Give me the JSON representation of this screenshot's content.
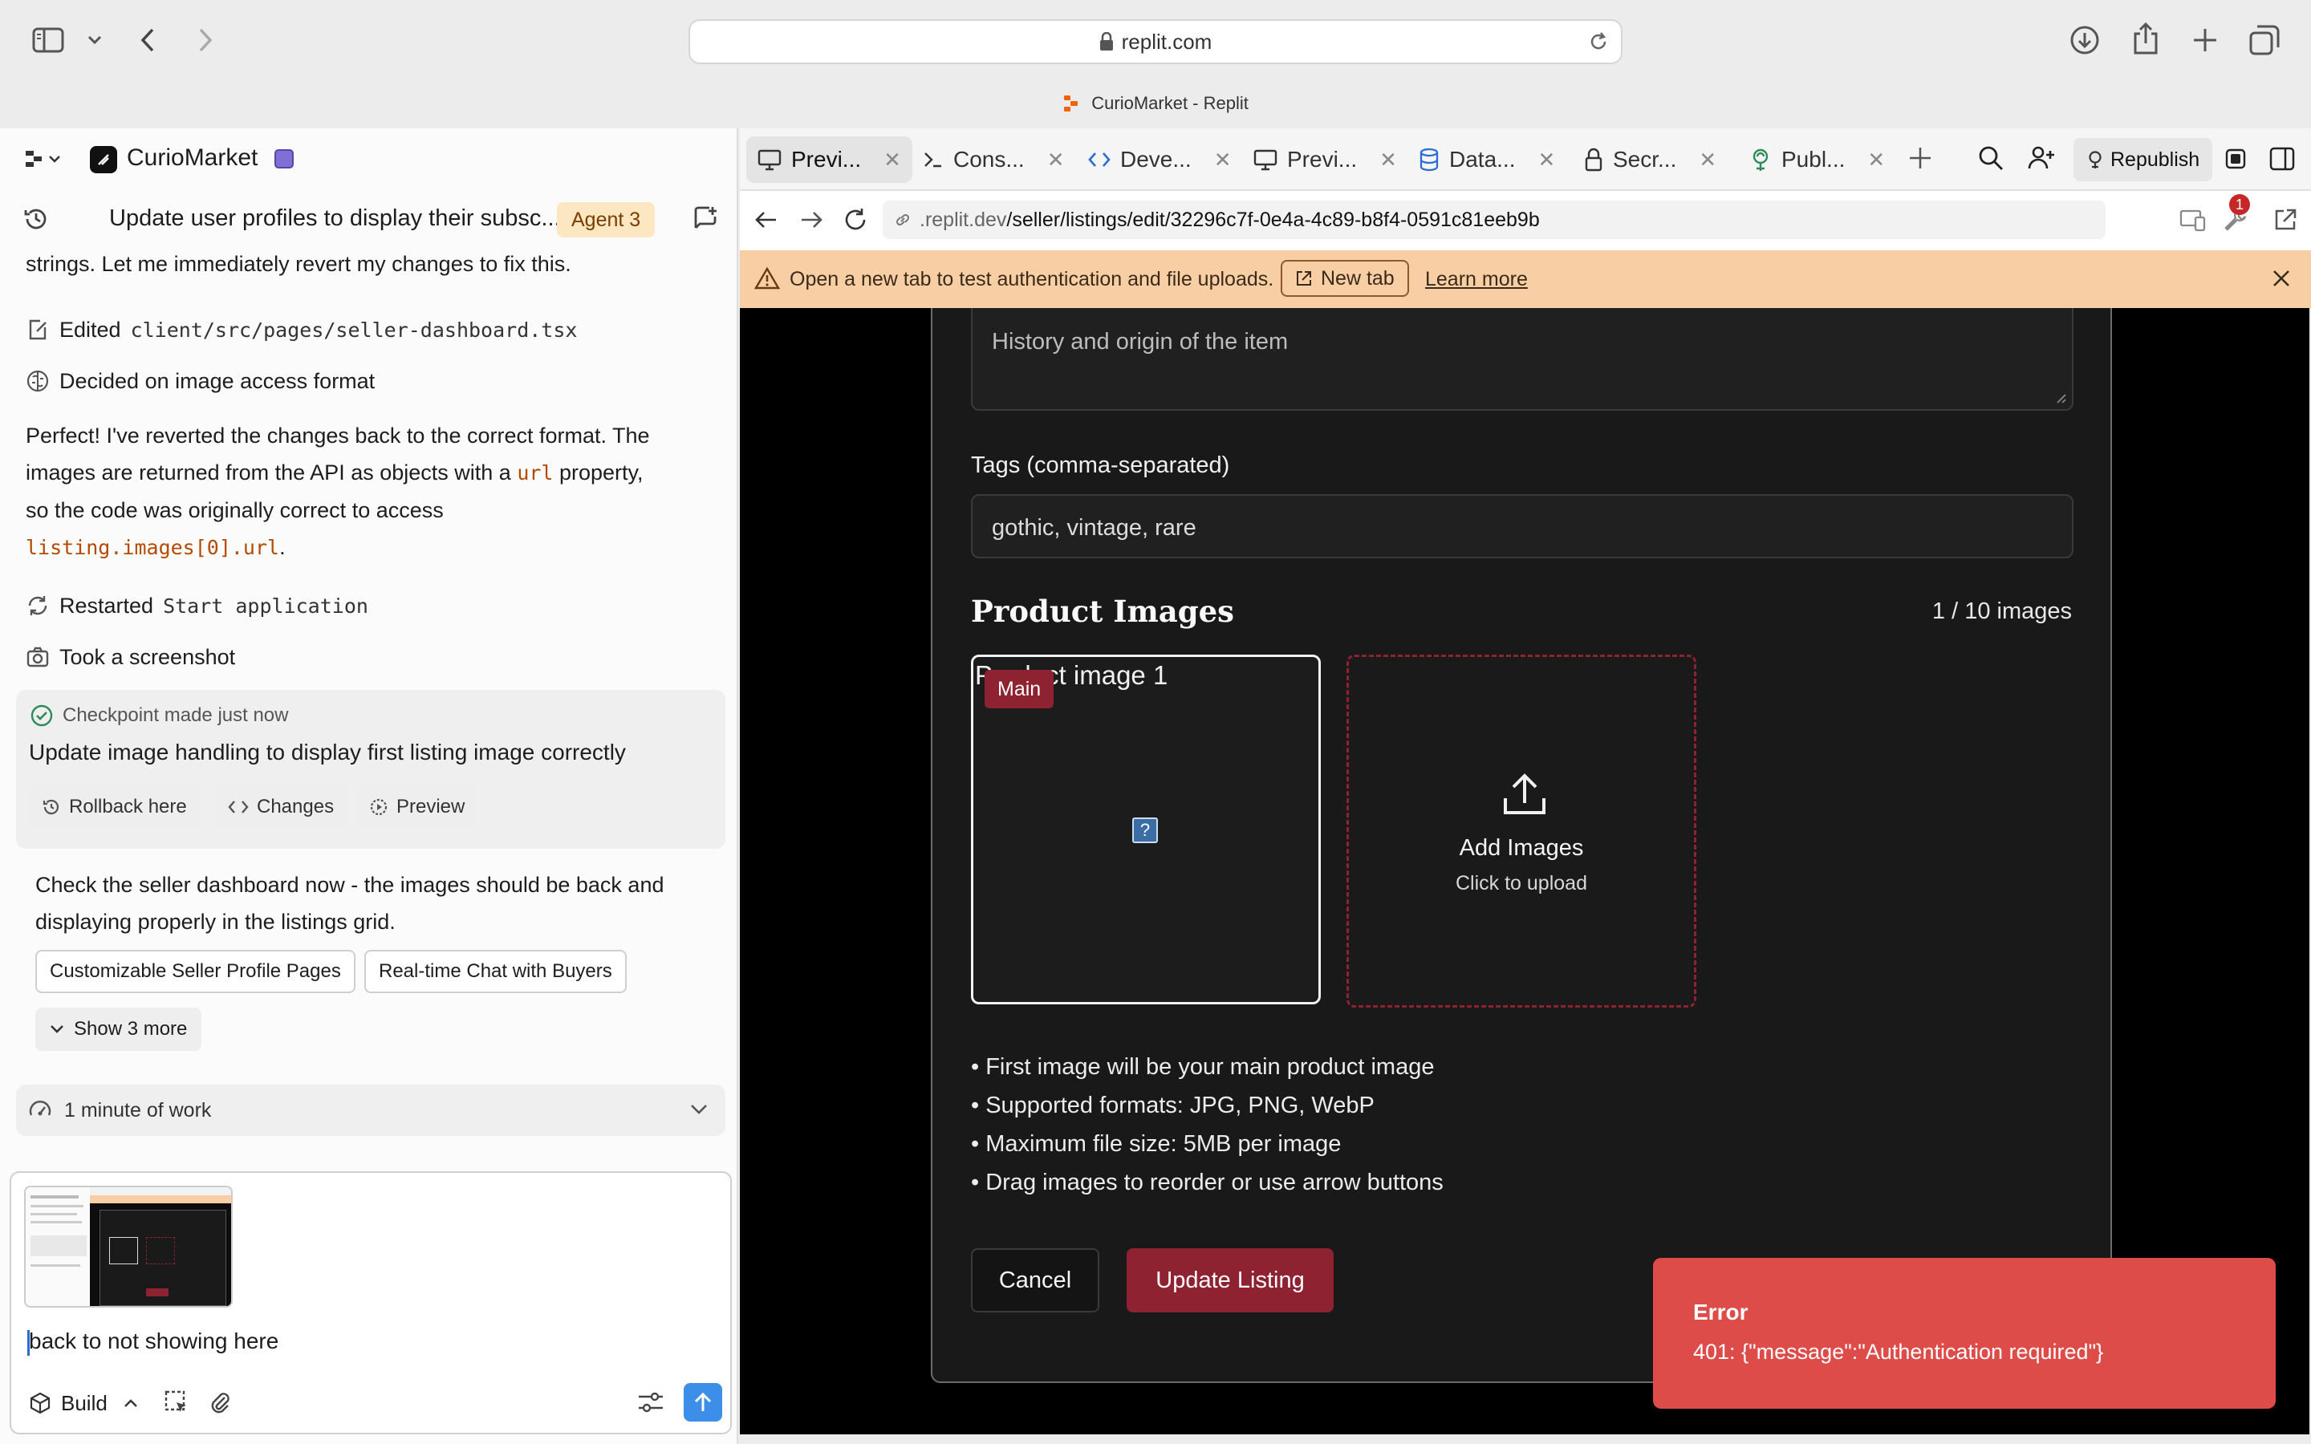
{
  "browser": {
    "url": "replit.com",
    "window_title": "CurioMarket - Replit"
  },
  "project": {
    "name": "CurioMarket"
  },
  "chat": {
    "header_title": "Update user profiles to display their subsc...",
    "agent_badge": "Agent 3",
    "intro_text": "strings. Let me immediately revert my changes to fix this.",
    "edited_prefix": "Edited",
    "edited_path": "client/src/pages/seller-dashboard.tsx",
    "decided_text": "Decided on image access format",
    "msg_line1": "Perfect! I've reverted the changes back to the correct format. The",
    "msg_line2a": "images are returned from the API as objects with a",
    "msg_code1": "url",
    "msg_line2b": "property,",
    "msg_line3": "so the code was originally correct to access",
    "msg_code2": "listing.images[0].url",
    "msg_line4": ".",
    "restarted_prefix": "Restarted",
    "restarted_name": "Start application",
    "screenshot_text": "Took a screenshot",
    "checkpoint_label": "Checkpoint made just now",
    "checkpoint_title": "Update image handling to display first listing image correctly",
    "rollback_label": "Rollback here",
    "changes_label": "Changes",
    "preview_label": "Preview",
    "final_line1": "Check the seller dashboard now - the images should be back and",
    "final_line2": "displaying properly in the listings grid.",
    "suggestions": [
      "Customizable Seller Profile Pages",
      "Real-time Chat with Buyers"
    ],
    "show_more_label": "Show 3 more",
    "work_time_label": "1 minute of work",
    "input_value": "back to not showing here",
    "build_label": "Build"
  },
  "tabs": [
    {
      "label": "Previ...",
      "icon": "monitor-icon"
    },
    {
      "label": "Cons...",
      "icon": "terminal-icon"
    },
    {
      "label": "Deve...",
      "icon": "code-icon"
    },
    {
      "label": "Previ...",
      "icon": "monitor-icon"
    },
    {
      "label": "Data...",
      "icon": "database-icon"
    },
    {
      "label": "Secr...",
      "icon": "lock-icon"
    },
    {
      "label": "Publ...",
      "icon": "publish-icon"
    }
  ],
  "toolbar": {
    "republish_label": "Republish",
    "notification_count": "1"
  },
  "preview": {
    "url_domain": ".replit.dev",
    "url_path": "/seller/listings/edit/32296c7f-0e4a-4c89-b8f4-0591c81eeb9b",
    "banner_text": "Open a new tab to test authentication and file uploads.",
    "new_tab_label": "New tab",
    "learn_more_label": "Learn more"
  },
  "form": {
    "history_placeholder": "History and origin of the item",
    "tags_label": "Tags (comma-separated)",
    "tags_value": "gothic, vintage, rare",
    "images_heading": "Product Images",
    "images_count": "1 / 10 images",
    "image_alt": "Product image 1",
    "main_badge": "Main",
    "add_images_label": "Add Images",
    "click_upload_label": "Click to upload",
    "bullets": [
      "• First image will be your main product image",
      "• Supported formats: JPG, PNG, WebP",
      "• Maximum file size: 5MB per image",
      "• Drag images to reorder or use arrow buttons"
    ],
    "cancel_label": "Cancel",
    "update_label": "Update Listing"
  },
  "toast": {
    "title": "Error",
    "message": "401: {\"message\":\"Authentication required\"}"
  },
  "colors": {
    "accent_red": "#8f2231",
    "toast_red": "#dd4c48",
    "banner_orange": "#f8cfa4"
  }
}
